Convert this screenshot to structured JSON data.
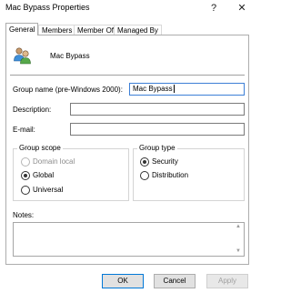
{
  "window": {
    "title": "Mac Bypass Properties",
    "help_glyph": "?",
    "close_glyph": "✕"
  },
  "tabs": [
    {
      "label": "General",
      "active": true
    },
    {
      "label": "Members",
      "active": false
    },
    {
      "label": "Member Of",
      "active": false
    },
    {
      "label": "Managed By",
      "active": false
    }
  ],
  "header": {
    "icon": "group-users-icon",
    "group_name": "Mac Bypass"
  },
  "fields": {
    "group_name_pre2000": {
      "label": "Group name (pre-Windows 2000):",
      "value": "Mac Bypass"
    },
    "description": {
      "label": "Description:",
      "value": ""
    },
    "email": {
      "label": "E-mail:",
      "value": ""
    }
  },
  "group_scope": {
    "label": "Group scope",
    "options": [
      {
        "label": "Domain local",
        "checked": false,
        "enabled": false
      },
      {
        "label": "Global",
        "checked": true,
        "enabled": true
      },
      {
        "label": "Universal",
        "checked": false,
        "enabled": true
      }
    ]
  },
  "group_type": {
    "label": "Group type",
    "options": [
      {
        "label": "Security",
        "checked": true,
        "enabled": true
      },
      {
        "label": "Distribution",
        "checked": false,
        "enabled": true
      }
    ]
  },
  "notes": {
    "label": "Notes:",
    "value": ""
  },
  "buttons": {
    "ok": "OK",
    "cancel": "Cancel",
    "apply": "Apply"
  },
  "colors": {
    "focus_border": "#3d7fd6",
    "default_button_border": "#0078d7"
  }
}
